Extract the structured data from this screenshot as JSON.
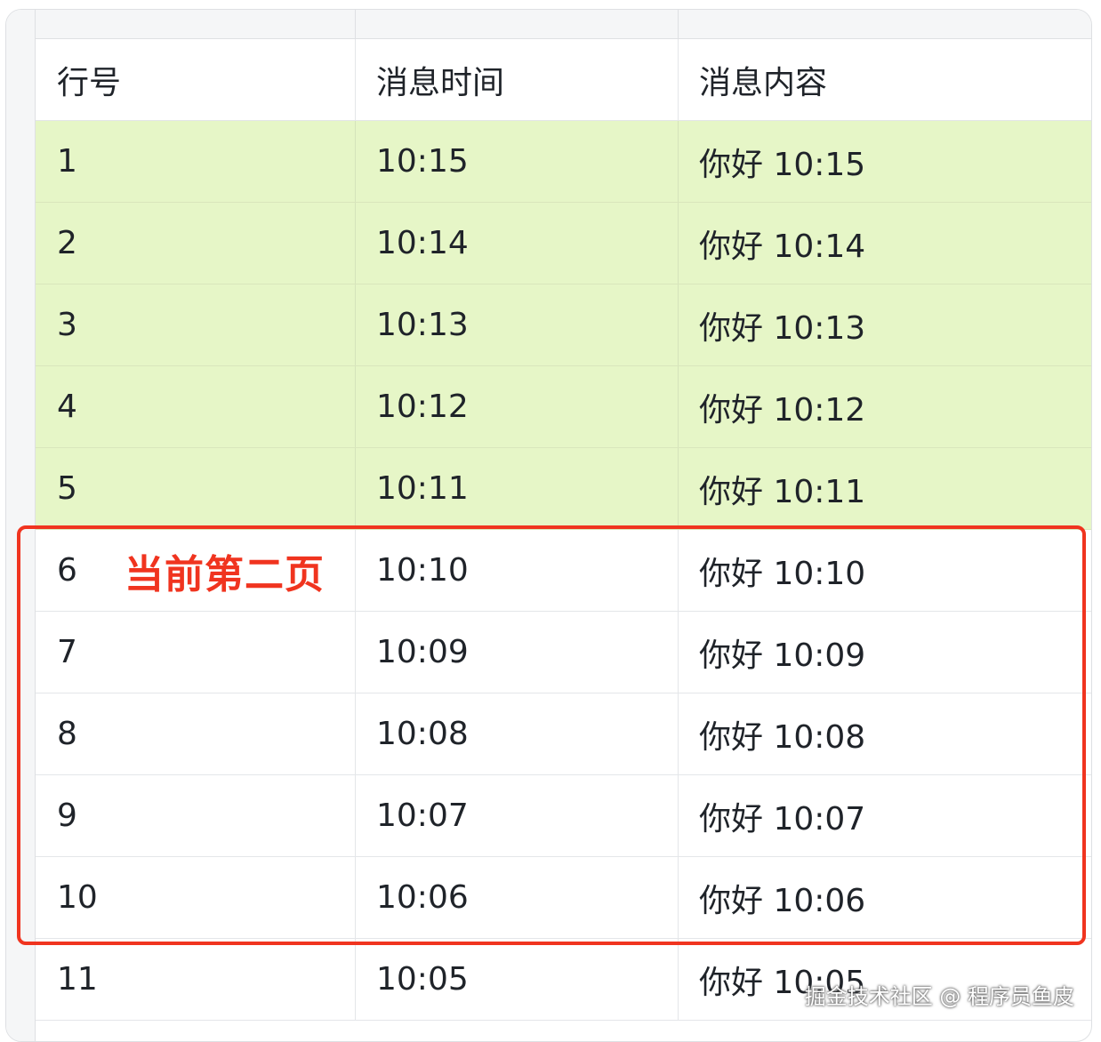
{
  "table": {
    "headers": [
      "行号",
      "消息时间",
      "消息内容"
    ],
    "rows": [
      {
        "line": "1",
        "time": "10:15",
        "content": "你好 10:15"
      },
      {
        "line": "2",
        "time": "10:14",
        "content": "你好 10:14"
      },
      {
        "line": "3",
        "time": "10:13",
        "content": "你好 10:13"
      },
      {
        "line": "4",
        "time": "10:12",
        "content": "你好 10:12"
      },
      {
        "line": "5",
        "time": "10:11",
        "content": "你好 10:11"
      },
      {
        "line": "6",
        "time": "10:10",
        "content": "你好 10:10"
      },
      {
        "line": "7",
        "time": "10:09",
        "content": "你好 10:09"
      },
      {
        "line": "8",
        "time": "10:08",
        "content": "你好 10:08"
      },
      {
        "line": "9",
        "time": "10:07",
        "content": "你好 10:07"
      },
      {
        "line": "10",
        "time": "10:06",
        "content": "你好 10:06"
      },
      {
        "line": "11",
        "time": "10:05",
        "content": "你好 10:05"
      }
    ]
  },
  "annotation": {
    "label": "当前第二页",
    "color": "#f0341f"
  },
  "colors": {
    "highlight_rows": "#e6f6c7"
  },
  "watermark": "掘金技术社区 @ 程序员鱼皮"
}
